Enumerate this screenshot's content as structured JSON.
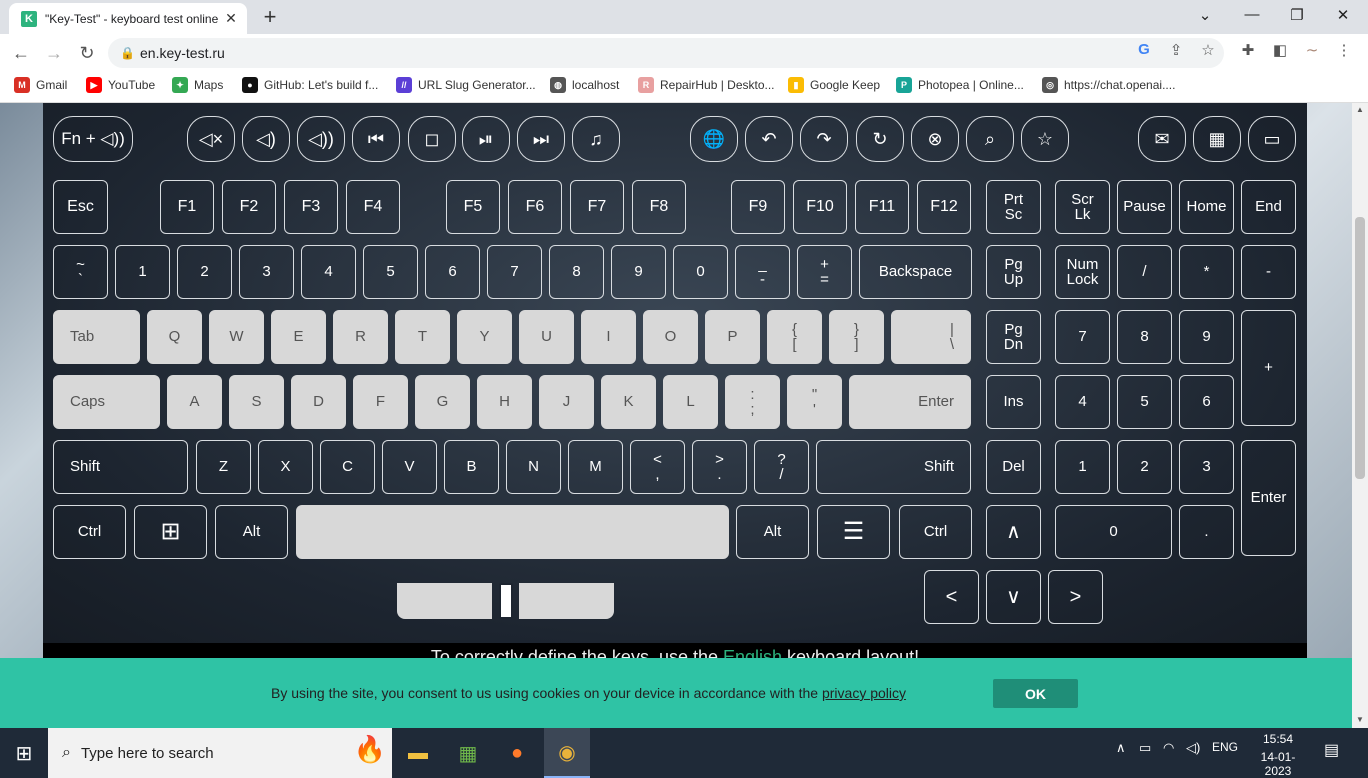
{
  "browser": {
    "tab_title": "\"Key-Test\" - keyboard test online",
    "favicon_letter": "K",
    "tab_close": "✕",
    "new_tab": "+",
    "url": "en.key-test.ru",
    "window_min": "—",
    "window_restore": "❐",
    "window_close": "✕",
    "window_menu": "⌄"
  },
  "bookmarks": [
    {
      "label": "Gmail",
      "icon": "gmail-icon",
      "color": "#d93025",
      "glyph": "M"
    },
    {
      "label": "YouTube",
      "icon": "youtube-icon",
      "color": "#ff0000",
      "glyph": "▶"
    },
    {
      "label": "Maps",
      "icon": "maps-icon",
      "color": "#34a853",
      "glyph": "✦"
    },
    {
      "label": "GitHub: Let's build f...",
      "icon": "github-icon",
      "color": "#111111",
      "glyph": "●"
    },
    {
      "label": "URL Slug Generator...",
      "icon": "slug-icon",
      "color": "#5b3fd6",
      "glyph": "//"
    },
    {
      "label": "localhost",
      "icon": "globe-icon",
      "color": "#555555",
      "glyph": "◍"
    },
    {
      "label": "RepairHub | Deskto...",
      "icon": "repairhub-icon",
      "color": "#e8a0a0",
      "glyph": "R"
    },
    {
      "label": "Google Keep",
      "icon": "keep-icon",
      "color": "#fbbc04",
      "glyph": "▮"
    },
    {
      "label": "Photopea | Online...",
      "icon": "photopea-icon",
      "color": "#18a497",
      "glyph": "P"
    },
    {
      "label": "https://chat.openai....",
      "icon": "openai-icon",
      "color": "#555555",
      "glyph": "◎"
    }
  ],
  "media_row": {
    "fn": "Fn + ◁))",
    "keys": [
      "◁×",
      "◁)",
      "◁))",
      "⏮",
      "◻",
      "⏯",
      "⏭",
      "♫",
      "🌐",
      "↶",
      "↷",
      "↻",
      "⊗",
      "⌕",
      "☆",
      "✉",
      "▦",
      "▭"
    ]
  },
  "fn_row": [
    "Esc",
    "F1",
    "F2",
    "F3",
    "F4",
    "F5",
    "F6",
    "F7",
    "F8",
    "F9",
    "F10",
    "F11",
    "F12"
  ],
  "nav_top": [
    [
      "Prt",
      "Sc"
    ],
    [
      "Scr",
      "Lk"
    ],
    "Pause",
    "Home",
    "End"
  ],
  "row_num": [
    [
      "~",
      "`"
    ],
    "1",
    "2",
    "3",
    "4",
    "5",
    "6",
    "7",
    "8",
    "9",
    "0",
    [
      "_",
      "-"
    ],
    [
      "+",
      "="
    ],
    "Backspace"
  ],
  "row_num_nav": [
    [
      "Pg",
      "Up"
    ],
    [
      "Num",
      "Lock"
    ],
    "/",
    "*",
    "-"
  ],
  "row_tab": [
    "Tab",
    "Q",
    "W",
    "E",
    "R",
    "T",
    "Y",
    "U",
    "I",
    "O",
    "P",
    [
      "{",
      "["
    ],
    [
      "}",
      "]"
    ],
    [
      "|",
      "\\"
    ]
  ],
  "row_tab_nav": [
    [
      "Pg",
      "Dn"
    ],
    "7",
    "8",
    "9",
    "+"
  ],
  "row_caps": [
    "Caps",
    "A",
    "S",
    "D",
    "F",
    "G",
    "H",
    "J",
    "K",
    "L",
    [
      ":",
      ";"
    ],
    [
      "\"",
      "'"
    ],
    "Enter"
  ],
  "row_caps_nav": [
    "Ins",
    "4",
    "5",
    "6"
  ],
  "row_shift": [
    "Shift",
    "Z",
    "X",
    "C",
    "V",
    "B",
    "N",
    "M",
    [
      "<",
      ","
    ],
    [
      ">",
      "."
    ],
    [
      "?",
      "/"
    ],
    "Shift"
  ],
  "row_shift_nav": [
    "Del",
    "1",
    "2",
    "3",
    "Enter"
  ],
  "row_ctrl": [
    "Ctrl",
    "⊞",
    "Alt",
    "",
    "Alt",
    "☰",
    "Ctrl"
  ],
  "row_ctrl_nav": [
    "∧",
    "0",
    "."
  ],
  "arrows": [
    "<",
    "∨",
    ">"
  ],
  "notice": {
    "before": "To correctly define the keys, use the ",
    "highlight": "English",
    "after": " keyboard layout!"
  },
  "cookie": {
    "text": "By using the site, you consent to us using cookies on your device in accordance with the ",
    "link": "privacy policy",
    "ok": "OK"
  },
  "taskbar": {
    "search_placeholder": "Type here to search",
    "language": "ENG",
    "time": "15:54",
    "date": "14-01-2023"
  }
}
